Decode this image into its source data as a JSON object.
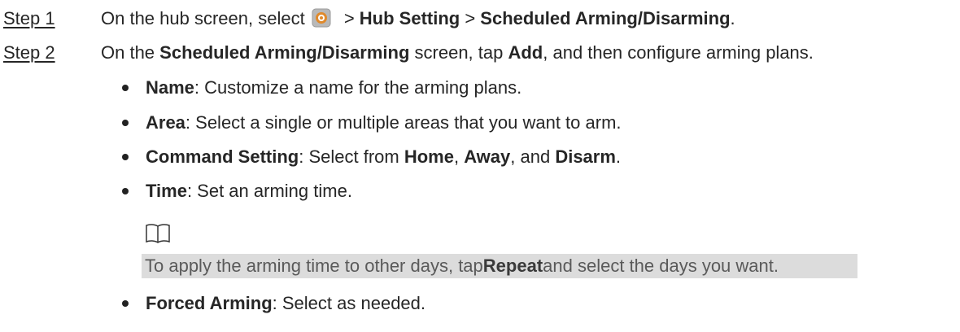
{
  "steps": [
    {
      "label": "Step 1",
      "pre": "On the hub screen, select",
      "sep1": " > ",
      "menu1": "Hub Setting",
      "sep2": " > ",
      "menu2": "Scheduled Arming/Disarming",
      "end": "."
    },
    {
      "label": "Step 2",
      "pre": "On the ",
      "screen": "Scheduled Arming/Disarming",
      "mid": " screen, tap ",
      "button": "Add",
      "end": ", and then configure arming plans."
    }
  ],
  "bullets": {
    "name": {
      "term": "Name",
      "text": ": Customize a name for the arming plans."
    },
    "area": {
      "term": "Area",
      "text": ": Select a single or multiple areas that you want to arm."
    },
    "command": {
      "term": "Command Setting",
      "text1": ": Select from ",
      "opt1": "Home",
      "sep1": ", ",
      "opt2": "Away",
      "sep2": ", and ",
      "opt3": "Disarm",
      "end": "."
    },
    "time": {
      "term": "Time",
      "text": ": Set an arming time."
    },
    "forced": {
      "term": "Forced Arming",
      "text": ": Select as needed."
    }
  },
  "note": {
    "icon": "book-icon",
    "pre": "To apply the arming time to other days, tap ",
    "button": "Repeat",
    "post": " and select the days you want."
  },
  "icons": {
    "hub": "hub-settings-icon"
  }
}
